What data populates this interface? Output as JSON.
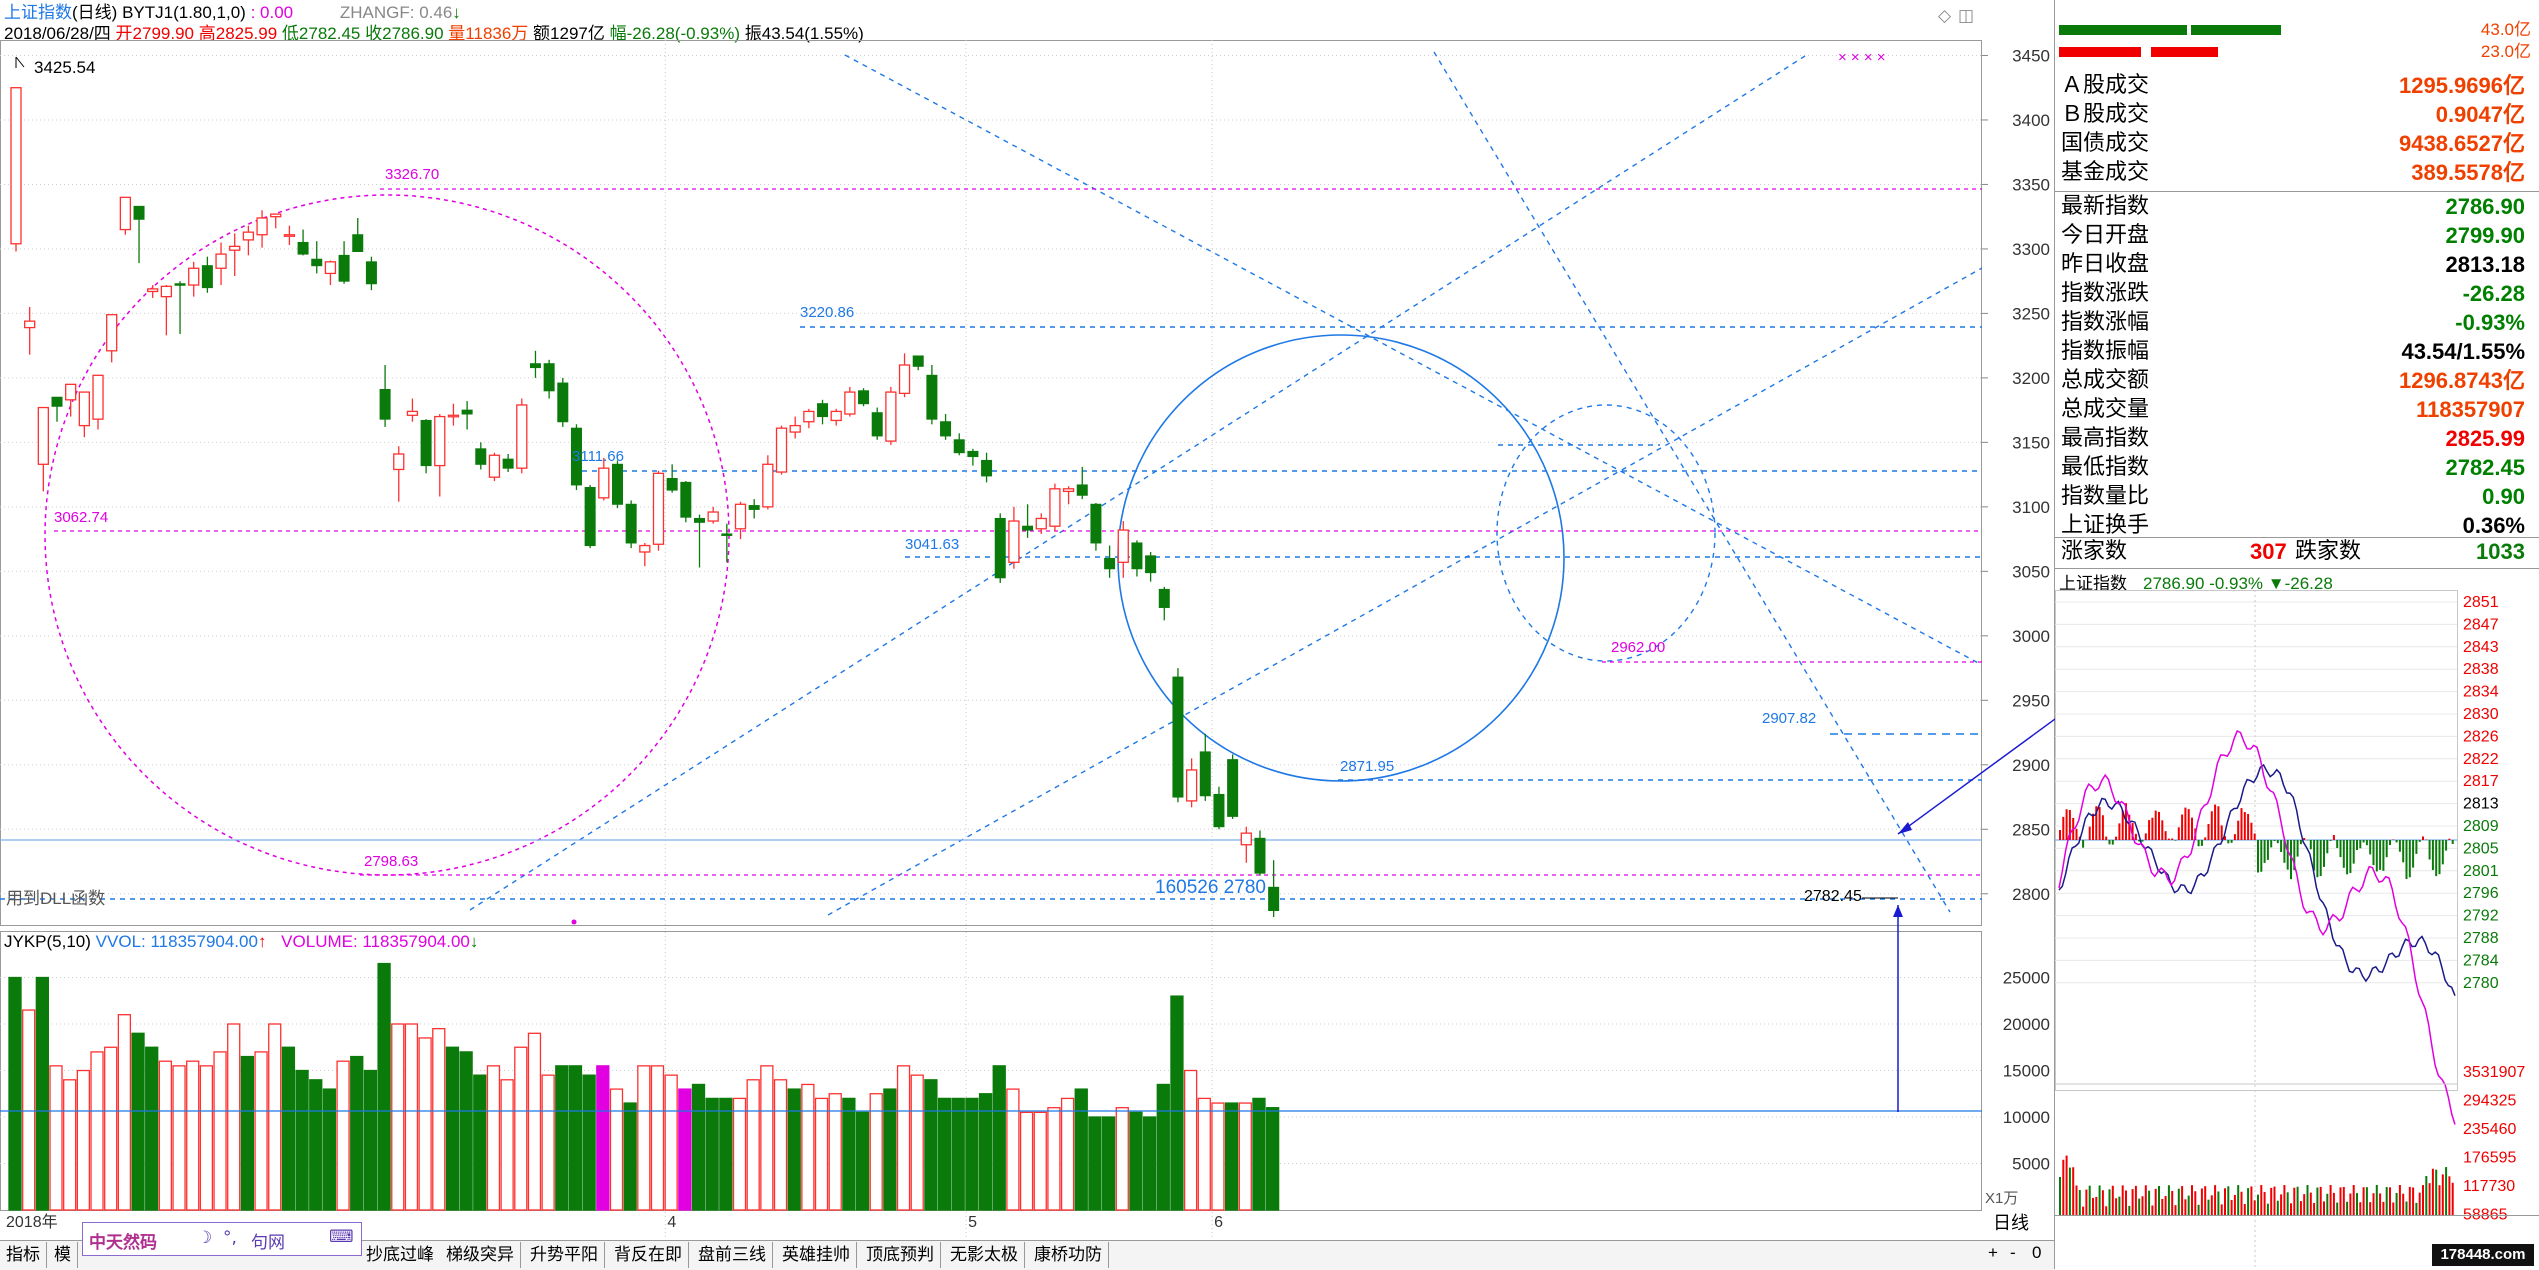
{
  "header": {
    "index_name": "上证指数",
    "period": "(日线)",
    "bytj": "BYTJ1(1.80,1,0)",
    "bytj_val": ": 0.00",
    "zhangf": "ZHANGF: 0.46",
    "date": "2018/06/28/四",
    "open": "开2799.90",
    "high": "高2825.99",
    "low": "低2782.45",
    "close": "收2786.90",
    "volume": "量11836万",
    "amount": "额1297亿",
    "change": "幅-26.28(-0.93%)",
    "amplitude": "振43.54(1.55%)"
  },
  "price_axis": {
    "min": 2775,
    "max": 3462,
    "ticks": [
      3450,
      3400,
      3350,
      3300,
      3250,
      3200,
      3150,
      3100,
      3050,
      3000,
      2950,
      2900,
      2850,
      2800
    ]
  },
  "annotations": {
    "peak": "3425.54",
    "a3326": "3326.70",
    "a3220": "3220.86",
    "a3111": "3111.66",
    "a3062": "3062.74",
    "a3041": "3041.63",
    "a2962": "2962.00",
    "a2907": "2907.82",
    "a2871": "2871.95",
    "a2798": "2798.63",
    "a2782": "2782.45",
    "dll": "用到DLL函数",
    "center_mark": "160526 2780"
  },
  "chart_data": {
    "type": "candlestick",
    "ohlc": [
      [
        3304,
        3425,
        3298,
        3415
      ],
      [
        3239,
        3244,
        3218,
        3255
      ],
      [
        3133,
        3177,
        3112,
        3174
      ],
      [
        3185,
        3178,
        3166,
        3180
      ],
      [
        3183,
        3195,
        3170,
        3194
      ],
      [
        3163,
        3189,
        3154,
        3164
      ],
      [
        3168,
        3202,
        3160,
        3198
      ],
      [
        3221,
        3249,
        3212,
        3241
      ],
      [
        3315,
        3340,
        3311,
        3334
      ],
      [
        3333,
        3323,
        3289,
        3324
      ],
      [
        3267,
        3269,
        3262,
        3272
      ],
      [
        3263,
        3271,
        3233,
        3272
      ],
      [
        3273,
        3272,
        3234,
        3275
      ],
      [
        3272,
        3285,
        3263,
        3290
      ],
      [
        3287,
        3270,
        3266,
        3294
      ],
      [
        3285,
        3296,
        3272,
        3305
      ],
      [
        3299,
        3302,
        3279,
        3312
      ],
      [
        3307,
        3313,
        3295,
        3318
      ],
      [
        3311,
        3324,
        3301,
        3330
      ],
      [
        3325,
        3327,
        3316,
        3326
      ],
      [
        3310,
        3311,
        3303,
        3318
      ],
      [
        3305,
        3296,
        3295,
        3315
      ],
      [
        3292,
        3287,
        3281,
        3306
      ],
      [
        3281,
        3290,
        3272,
        3291
      ],
      [
        3295,
        3275,
        3273,
        3306
      ],
      [
        3311,
        3298,
        3300,
        3324
      ],
      [
        3290,
        3273,
        3268,
        3294
      ],
      [
        3191,
        3168,
        3162,
        3210
      ],
      [
        3129,
        3141,
        3104,
        3147
      ],
      [
        3171,
        3174,
        3166,
        3184
      ],
      [
        3167,
        3132,
        3126,
        3168
      ],
      [
        3132,
        3170,
        3108,
        3172
      ],
      [
        3170,
        3171,
        3163,
        3180
      ],
      [
        3175,
        3172,
        3160,
        3182
      ],
      [
        3145,
        3133,
        3129,
        3150
      ],
      [
        3123,
        3140,
        3120,
        3142
      ],
      [
        3137,
        3130,
        3127,
        3141
      ],
      [
        3130,
        3179,
        3126,
        3184
      ],
      [
        3211,
        3208,
        3200,
        3221
      ],
      [
        3211,
        3190,
        3184,
        3214
      ],
      [
        3196,
        3166,
        3162,
        3200
      ],
      [
        3161,
        3117,
        3113,
        3164
      ],
      [
        3115,
        3070,
        3068,
        3117
      ],
      [
        3107,
        3130,
        3105,
        3138
      ],
      [
        3133,
        3102,
        3099,
        3136
      ],
      [
        3102,
        3072,
        3068,
        3105
      ],
      [
        3065,
        3070,
        3054,
        3072
      ],
      [
        3071,
        3126,
        3066,
        3128
      ],
      [
        3122,
        3113,
        3111,
        3133
      ],
      [
        3119,
        3092,
        3088,
        3120
      ],
      [
        3091,
        3088,
        3053,
        3094
      ],
      [
        3089,
        3096,
        3087,
        3100
      ],
      [
        3079,
        3078,
        3057,
        3087
      ],
      [
        3083,
        3102,
        3075,
        3104
      ],
      [
        3101,
        3098,
        3091,
        3106
      ],
      [
        3100,
        3133,
        3098,
        3140
      ],
      [
        3127,
        3161,
        3125,
        3163
      ],
      [
        3158,
        3163,
        3153,
        3170
      ],
      [
        3166,
        3174,
        3161,
        3176
      ],
      [
        3180,
        3170,
        3164,
        3183
      ],
      [
        3167,
        3174,
        3163,
        3176
      ],
      [
        3172,
        3189,
        3170,
        3193
      ],
      [
        3190,
        3180,
        3178,
        3192
      ],
      [
        3173,
        3155,
        3152,
        3177
      ],
      [
        3151,
        3189,
        3148,
        3193
      ],
      [
        3188,
        3210,
        3185,
        3219
      ],
      [
        3217,
        3209,
        3206,
        3214
      ],
      [
        3202,
        3168,
        3164,
        3210
      ],
      [
        3166,
        3155,
        3152,
        3172
      ],
      [
        3152,
        3142,
        3140,
        3157
      ],
      [
        3143,
        3139,
        3132,
        3145
      ],
      [
        3136,
        3124,
        3119,
        3142
      ],
      [
        3091,
        3045,
        3041,
        3095
      ],
      [
        3057,
        3089,
        3052,
        3100
      ],
      [
        3085,
        3082,
        3076,
        3102
      ],
      [
        3083,
        3091,
        3079,
        3095
      ],
      [
        3085,
        3114,
        3081,
        3118
      ],
      [
        3112,
        3114,
        3102,
        3116
      ],
      [
        3117,
        3109,
        3106,
        3131
      ],
      [
        3102,
        3072,
        3066,
        3103
      ],
      [
        3060,
        3052,
        3045,
        3070
      ],
      [
        3057,
        3082,
        3045,
        3089
      ],
      [
        3072,
        3052,
        3046,
        3074
      ],
      [
        3062,
        3049,
        3042,
        3065
      ],
      [
        3036,
        3022,
        3012,
        3038
      ],
      [
        2968,
        2875,
        2871,
        2975
      ],
      [
        2872,
        2896,
        2867,
        2905
      ],
      [
        2910,
        2876,
        2872,
        2924
      ],
      [
        2877,
        2852,
        2850,
        2883
      ],
      [
        2904,
        2860,
        2858,
        2908
      ],
      [
        2838,
        2847,
        2824,
        2852
      ],
      [
        2843,
        2816,
        2814,
        2849
      ],
      [
        2805,
        2787,
        2782,
        2826
      ]
    ],
    "volume_axis": {
      "min": 0,
      "max": 30000,
      "ticks": [
        25000,
        20000,
        15000,
        10000,
        5000
      ]
    },
    "volumes": [
      [
        25000,
        0
      ],
      [
        21500,
        1
      ],
      [
        25000,
        0
      ],
      [
        15500,
        1
      ],
      [
        14000,
        1
      ],
      [
        15000,
        1
      ],
      [
        17000,
        1
      ],
      [
        17500,
        1
      ],
      [
        21000,
        1
      ],
      [
        19000,
        0
      ],
      [
        17500,
        0
      ],
      [
        16000,
        1
      ],
      [
        15500,
        1
      ],
      [
        16000,
        1
      ],
      [
        15500,
        1
      ],
      [
        17000,
        1
      ],
      [
        20000,
        1
      ],
      [
        16500,
        0
      ],
      [
        17000,
        1
      ],
      [
        20000,
        1
      ],
      [
        17500,
        0
      ],
      [
        15000,
        0
      ],
      [
        14000,
        0
      ],
      [
        13000,
        0
      ],
      [
        16000,
        1
      ],
      [
        16500,
        0
      ],
      [
        15000,
        0
      ],
      [
        26500,
        0
      ],
      [
        20000,
        1
      ],
      [
        20000,
        1
      ],
      [
        18500,
        1
      ],
      [
        19500,
        1
      ],
      [
        17500,
        0
      ],
      [
        17000,
        0
      ],
      [
        14500,
        0
      ],
      [
        15500,
        1
      ],
      [
        14000,
        1
      ],
      [
        17500,
        1
      ],
      [
        19000,
        1
      ],
      [
        14500,
        1
      ],
      [
        15500,
        0
      ],
      [
        15500,
        0
      ],
      [
        14500,
        0
      ],
      [
        15500,
        1
      ],
      [
        13000,
        1
      ],
      [
        11500,
        0
      ],
      [
        15500,
        1
      ],
      [
        15500,
        1
      ],
      [
        14500,
        1
      ],
      [
        13000,
        0
      ],
      [
        13500,
        0
      ],
      [
        12000,
        0
      ],
      [
        12000,
        0
      ],
      [
        12000,
        1
      ],
      [
        14000,
        1
      ],
      [
        15500,
        1
      ],
      [
        14000,
        1
      ],
      [
        13000,
        0
      ],
      [
        13500,
        1
      ],
      [
        12000,
        1
      ],
      [
        12500,
        1
      ],
      [
        12000,
        0
      ],
      [
        10500,
        0
      ],
      [
        12500,
        1
      ],
      [
        13000,
        0
      ],
      [
        15500,
        1
      ],
      [
        14500,
        1
      ],
      [
        14000,
        0
      ],
      [
        12000,
        0
      ],
      [
        12000,
        0
      ],
      [
        12000,
        0
      ],
      [
        12500,
        0
      ],
      [
        15500,
        0
      ],
      [
        13000,
        1
      ],
      [
        10500,
        1
      ],
      [
        10500,
        1
      ],
      [
        11000,
        1
      ],
      [
        12000,
        1
      ],
      [
        13000,
        0
      ],
      [
        10000,
        0
      ],
      [
        10000,
        0
      ],
      [
        11000,
        1
      ],
      [
        10500,
        0
      ],
      [
        10000,
        0
      ],
      [
        13500,
        0
      ],
      [
        23000,
        0
      ],
      [
        15000,
        1
      ],
      [
        12000,
        1
      ],
      [
        11500,
        1
      ],
      [
        11500,
        0
      ],
      [
        11500,
        1
      ],
      [
        12000,
        0
      ],
      [
        11000,
        0
      ]
    ],
    "month_labels": [
      {
        "i": 0,
        "label": "2018年"
      },
      {
        "i": 48,
        "label": "4"
      },
      {
        "i": 70,
        "label": "5"
      },
      {
        "i": 88,
        "label": "6"
      }
    ]
  },
  "volume_header": {
    "jykp": "JYKP(5,10)",
    "vvol": "VVOL: 118357904.00",
    "volume": "VOLUME: 118357904.00"
  },
  "right_panel": {
    "bar_labels": [
      "43.0亿",
      "23.0亿"
    ],
    "rows1": [
      {
        "label": "Ａ股成交",
        "value": "1295.9696亿",
        "color": "#f04000"
      },
      {
        "label": "Ｂ股成交",
        "value": "0.9047亿",
        "color": "#f04000"
      },
      {
        "label": "国债成交",
        "value": "9438.6527亿",
        "color": "#f04000"
      },
      {
        "label": "基金成交",
        "value": "389.5578亿",
        "color": "#f04000"
      }
    ],
    "rows2": [
      {
        "label": "最新指数",
        "value": "2786.90",
        "color": "#008000"
      },
      {
        "label": "今日开盘",
        "value": "2799.90",
        "color": "#008000"
      },
      {
        "label": "昨日收盘",
        "value": "2813.18",
        "color": "#000000"
      },
      {
        "label": "指数涨跌",
        "value": "-26.28",
        "color": "#008000"
      },
      {
        "label": "指数涨幅",
        "value": "-0.93%",
        "color": "#008000"
      },
      {
        "label": "指数振幅",
        "value": "43.54/1.55%",
        "color": "#000000"
      },
      {
        "label": "总成交额",
        "value": "1296.8743亿",
        "color": "#f04000"
      },
      {
        "label": "总成交量",
        "value": "118357907",
        "color": "#f04000"
      },
      {
        "label": "最高指数",
        "value": "2825.99",
        "color": "#f00000"
      },
      {
        "label": "最低指数",
        "value": "2782.45",
        "color": "#008000"
      },
      {
        "label": "指数量比",
        "value": "0.90",
        "color": "#008000"
      },
      {
        "label": "上证换手",
        "value": "0.36%",
        "color": "#000000"
      }
    ],
    "up_label": "涨家数",
    "up_value": "307",
    "down_label": "跌家数",
    "down_value": "1033",
    "mini_title": "上证指数",
    "mini_values": "2786.90 -0.93% ▼-26.28",
    "mini_price_ticks": [
      "2851",
      "2847",
      "2843",
      "2838",
      "2834",
      "2830",
      "2826",
      "2822",
      "2817",
      "2813",
      "2809",
      "2805",
      "2801",
      "2796",
      "2792",
      "2788",
      "2784",
      "2780"
    ],
    "mini_vol_ticks": [
      "3531907",
      "294325",
      "235460",
      "176595",
      "117730",
      "58865"
    ],
    "bottom_label": "日线"
  },
  "bottom_tabs": [
    "指标",
    "模",
    "抄底过峰",
    "梯级突异",
    "升势平阳",
    "背反在即",
    "盘前三线",
    "英雄挂帅",
    "顶底预判",
    "无影太极",
    "康桥功防"
  ],
  "toolbar": {
    "brand": "中天然码",
    "sym1": "☽",
    "sym2": "°,",
    "sym3": "句网",
    "kb": "⌨"
  },
  "misc": {
    "x1": "X1万",
    "plus": "+",
    "minus": "-",
    "zero": "0",
    "watermark": "178448.com"
  },
  "colors": {
    "up": "#ff3030",
    "down": "#0a7a0a",
    "accent": "#1e78e6",
    "magenta": "#e000e0",
    "dark": "#000000"
  }
}
